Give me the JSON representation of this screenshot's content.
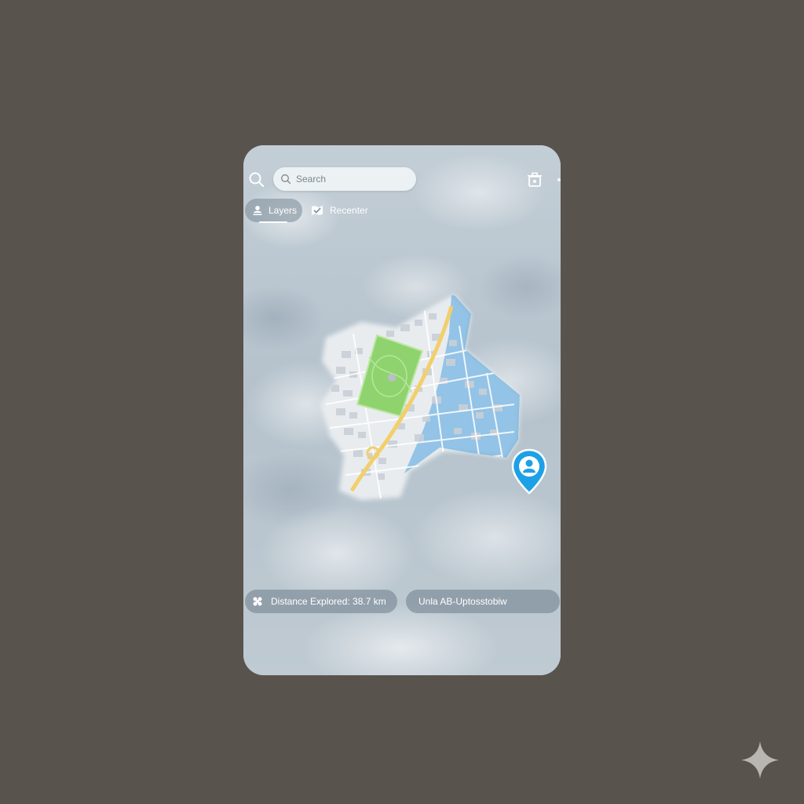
{
  "search": {
    "placeholder": "Search"
  },
  "toolbar": {
    "layers_label": "Layers",
    "recenter_label": "Recenter"
  },
  "stats": {
    "distance_label": "Distance Explored: 38.7 km",
    "unlock_label": "Unla AB-Uptosstobiw"
  },
  "icons": {
    "top_left": "search-icon",
    "search_field": "magnifier-icon",
    "top_right": "trash-icon",
    "layers": "user-stack-icon",
    "recenter": "map-check-icon",
    "distance": "footprint-icon",
    "user_marker": "user-location-pin-icon",
    "watermark": "sparkle-icon"
  },
  "colors": {
    "background": "#59534e",
    "explored_blue": "#5aa9df",
    "park_green": "#8fd36e",
    "road_yellow": "#f2cf6b",
    "pin_blue": "#1da1e6"
  }
}
